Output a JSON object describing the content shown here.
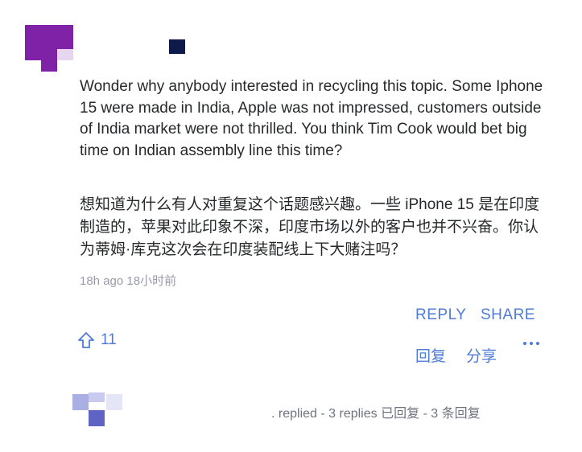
{
  "comment": {
    "text_en": "Wonder why anybody interested in recycling this topic. Some Iphone 15 were made in India, Apple was not impressed, customers outside of India market were not thrilled. You think Tim Cook would bet big time on Indian assembly line this time?",
    "text_zh": "想知道为什么有人对重复这个话题感兴趣。一些 iPhone 15 是在印度制造的，苹果对此印象不深，印度市场以外的客户也并不兴奋。你认为蒂姆·库克这次会在印度装配线上下大赌注吗？",
    "timestamp": "18h ago 18小时前"
  },
  "actions": {
    "reply_label": "REPLY",
    "share_label": "SHARE",
    "reply_label_zh": "回复",
    "share_label_zh": "分享",
    "more_icon": "more-dots-icon"
  },
  "votes": {
    "upvote_icon": "thumbs-up-icon",
    "count": "11"
  },
  "replies_summary": {
    "text": ". replied - 3 replies 已回复 - 3 条回复"
  },
  "colors": {
    "accent": "#4f7bd6",
    "avatar": "#7f22a8",
    "text": "#26282a",
    "muted": "#979ba7"
  }
}
